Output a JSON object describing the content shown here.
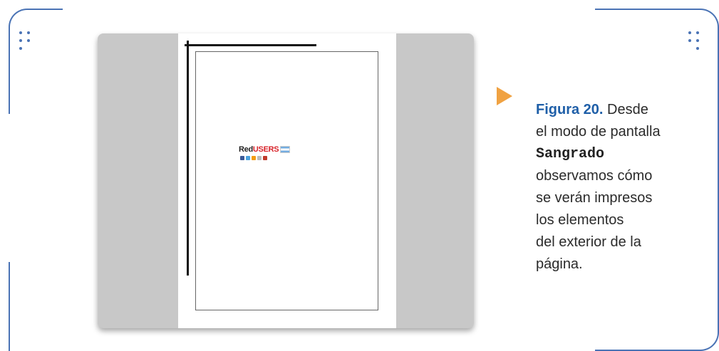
{
  "figure": {
    "label": "Figura 20.",
    "lines": [
      "Desde",
      "el modo de pantalla",
      "Sangrado",
      "observamos cómo",
      "se verán impresos",
      "los elementos",
      "del exterior de la",
      "página."
    ]
  },
  "screenshot": {
    "logo_prefix": "Red",
    "logo_brand": "USERS",
    "social_icons": [
      "facebook-icon",
      "twitter-icon",
      "rss-icon",
      "mail-icon",
      "youtube-icon"
    ]
  },
  "colors": {
    "frame": "#4a73b5",
    "arrow": "#f0a242",
    "figure_label": "#1f5fa8",
    "logo_red": "#d8232a"
  }
}
